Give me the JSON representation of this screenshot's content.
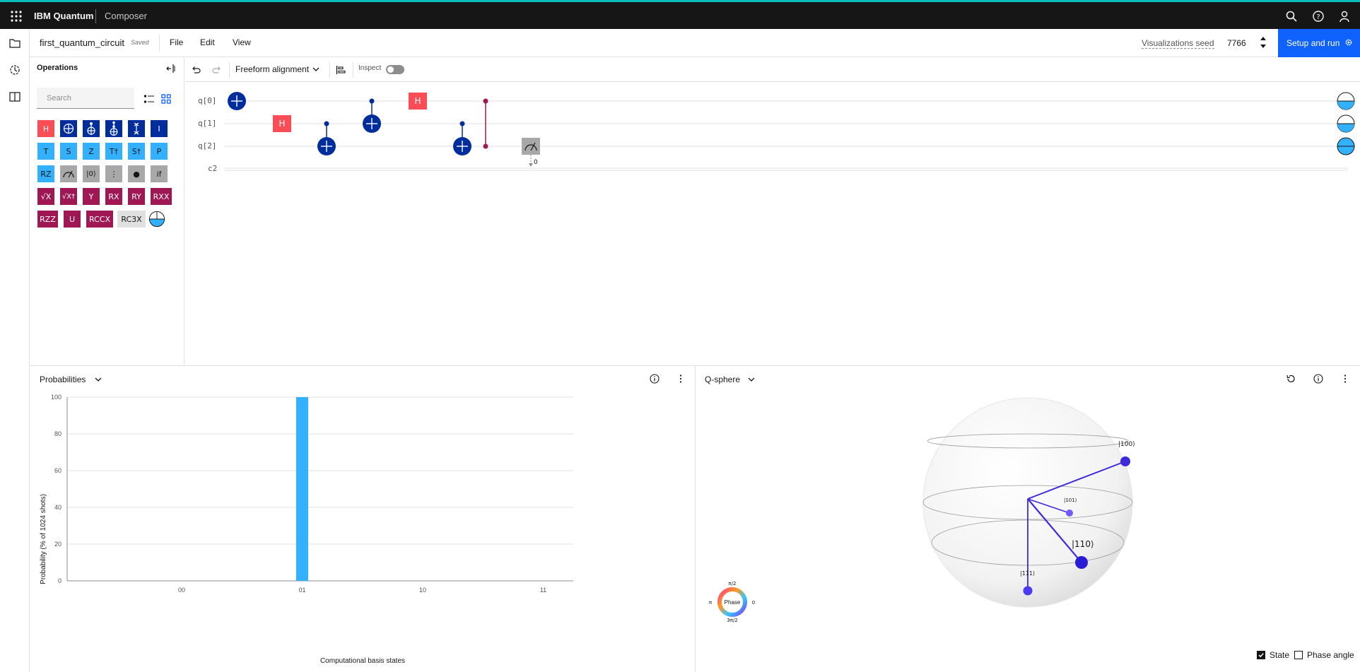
{
  "topbar": {
    "brand": "IBM Quantum",
    "product": "Composer",
    "icons": [
      "app-switcher-icon",
      "search-icon",
      "help-icon",
      "user-icon"
    ]
  },
  "rail": {
    "icons": [
      "folder-icon",
      "history-icon",
      "panel-icon"
    ]
  },
  "file": {
    "name": "first_quantum_circuit",
    "status": "Saved",
    "menus": [
      "File",
      "Edit",
      "View"
    ],
    "seed_label": "Visualizations seed",
    "seed_value": "7766",
    "run_label": "Setup and run"
  },
  "operations": {
    "title": "Operations",
    "search_placeholder": "Search",
    "gates": [
      [
        "H",
        "⊕",
        "",
        "",
        "",
        "I"
      ],
      [
        "T",
        "S",
        "Z",
        "T†",
        "S†",
        "P"
      ],
      [
        "RZ",
        "",
        "|0⟩",
        "⋮",
        "●",
        "if"
      ],
      [
        "√X",
        "√X†",
        "Y",
        "RX",
        "RY",
        "RXX"
      ],
      [
        "RZZ",
        "U",
        "RCCX",
        "RC3X",
        ""
      ]
    ]
  },
  "circuit_toolbar": {
    "alignment": "Freeform alignment",
    "inspect": "Inspect"
  },
  "circuit": {
    "wires": [
      "q[0]",
      "q[1]",
      "q[2]",
      "c2"
    ],
    "gate_labels": {
      "h": "H"
    },
    "measure_bit": "0"
  },
  "probabilities": {
    "title": "Probabilities",
    "chart_data": {
      "type": "bar",
      "categories": [
        "00",
        "01",
        "10",
        "11"
      ],
      "values": [
        0,
        100,
        0,
        0
      ],
      "xlabel": "Computational basis states",
      "ylabel": "Probability (% of 1024 shots)",
      "ylim": [
        0,
        100
      ],
      "yticks": [
        0,
        20,
        40,
        60,
        80,
        100
      ],
      "color": "#33b1ff",
      "grid": true
    }
  },
  "qsphere": {
    "title": "Q-sphere",
    "states": [
      "|100⟩",
      "|101⟩",
      "|110⟩",
      "|111⟩"
    ],
    "phase_wheel": {
      "label": "Phase",
      "top": "π/2",
      "left": "π",
      "right": "0",
      "bottom": "3π/2"
    },
    "options": [
      {
        "label": "State",
        "checked": true
      },
      {
        "label": "Phase angle",
        "checked": false
      }
    ],
    "state_color": "#3d2bdb"
  }
}
